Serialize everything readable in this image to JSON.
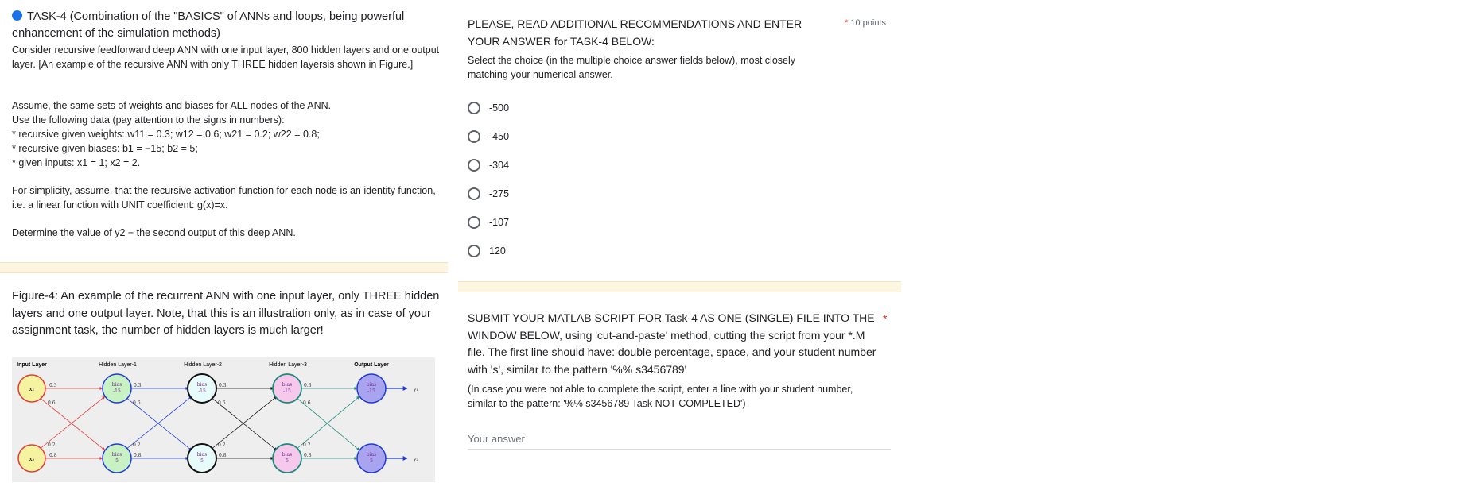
{
  "left": {
    "task_title": "TASK-4 (Combination of the \"BASICS\" of ANNs and loops, being powerful enhancement of the simulation methods)",
    "desc1": "Consider recursive feedforward deep ANN with one input layer, 800 hidden layers and one output layer. [An example of the recursive ANN with only THREE hidden layersis shown in Figure.]",
    "assume": "Assume, the same sets of weights and biases for ALL nodes of the ANN.",
    "use_data": "Use the following data (pay attention to the signs in numbers):",
    "weights": "* recursive given weights: w11 = 0.3; w12 = 0.6; w21 = 0.2; w22 = 0.8;",
    "biases": "* recursive given biases: b1 = −15; b2 = 5;",
    "inputs": "* given inputs: x1 = 1; x2 = 2.",
    "simplicity": "For simplicity, assume, that the recursive activation function for each node is an identity function, i.e. a linear function with UNIT coefficient: g(x)=x.",
    "determine": "Determine the value of y2 − the second output of this deep ANN.",
    "figure_caption": "Figure-4: An example of the recurrent ANN with one input layer, only THREE hidden layers and one output layer. Note, that this is an illustration only, as in case of your assignment task, the number of hidden layers is much larger!"
  },
  "figure": {
    "layer_titles": [
      "Input Layer",
      "Hidden Layer-1",
      "Hidden Layer-2",
      "Hidden Layer-3",
      "Output Layer"
    ],
    "input_labels": [
      "x₁",
      "x₂"
    ],
    "bias_word": "bias",
    "bias_top": "-15",
    "bias_bottom": "5",
    "w11": "0.3",
    "w12": "0.6",
    "w21": "0.2",
    "w22": "0.8",
    "outputs": [
      "y₁",
      "y₂"
    ]
  },
  "question": {
    "title": "PLEASE, READ ADDITIONAL RECOMMENDATIONS AND ENTER YOUR ANSWER for TASK-4 BELOW:",
    "required_mark": "*",
    "points": "10 points",
    "subtitle": "Select the choice (in the multiple choice answer fields below), most closely matching your numerical answer.",
    "options": [
      "-500",
      "-450",
      "-304",
      "-275",
      "-107",
      "120"
    ]
  },
  "submit": {
    "title": "SUBMIT YOUR MATLAB SCRIPT FOR Task-4 AS ONE (SINGLE) FILE INTO THE WINDOW BELOW, using 'cut-and-paste' method, cutting the script from your *.M file. The first line should have: double percentage, space, and your student number with 's', similar to the pattern '%% s3456789'",
    "required_mark": "*",
    "subtitle": "(In case you were not able to complete the script, enter a line with your student number, similar to the pattern: '%% s3456789 Task NOT COMPLETED')",
    "answer_placeholder": "Your answer"
  }
}
